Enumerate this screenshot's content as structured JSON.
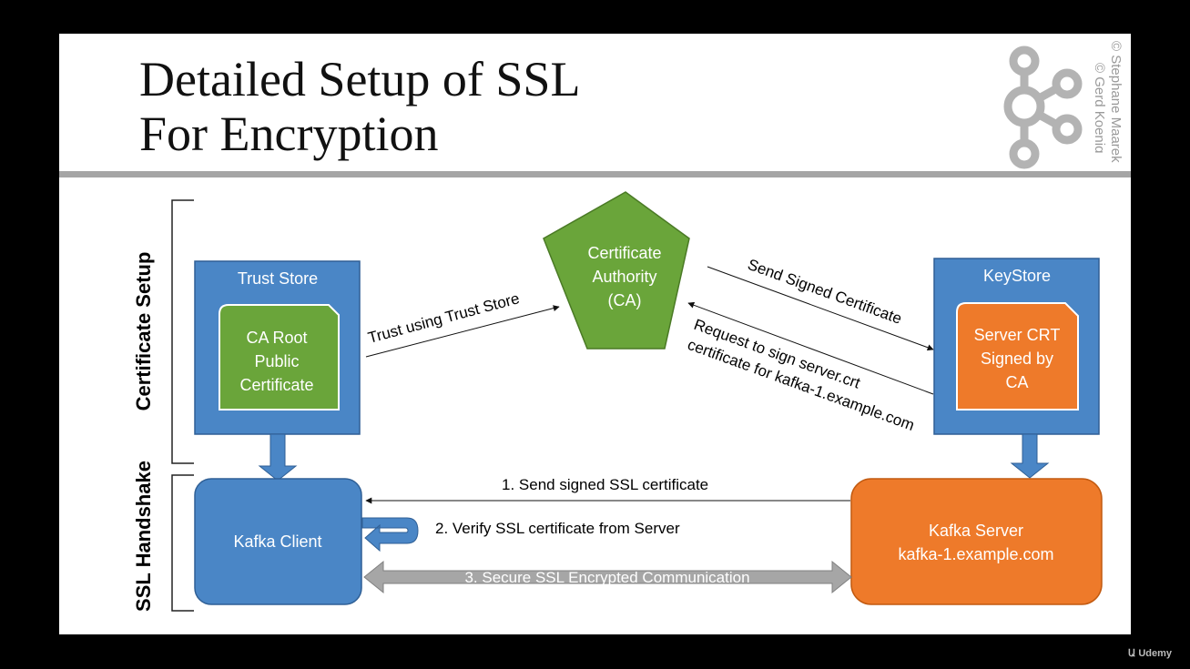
{
  "title": {
    "line1": "Detailed Setup of SSL",
    "line2": "For Encryption"
  },
  "copyright": {
    "line1": "© Stephane Maarek",
    "line2": "© Gerd Koenig"
  },
  "sections": {
    "certificate_setup": "Certificate Setup",
    "ssl_handshake": "SSL Handshake"
  },
  "trust_store": {
    "label": "Trust Store",
    "cert_line1": "CA Root",
    "cert_line2": "Public",
    "cert_line3": "Certificate"
  },
  "ca": {
    "line1": "Certificate",
    "line2": "Authority",
    "line3": "(CA)"
  },
  "keystore": {
    "label": "KeyStore",
    "cert_line1": "Server CRT",
    "cert_line2": "Signed by",
    "cert_line3": "CA"
  },
  "edges": {
    "trust": "Trust using Trust Store",
    "send_signed": "Send Signed Certificate",
    "request_line1": "Request to sign server.crt",
    "request_line2": "certificate for kafka-1.example.com",
    "step1": "1. Send signed SSL certificate",
    "step2": "2. Verify SSL certificate from Server",
    "step3": "3. Secure SSL Encrypted Communication"
  },
  "kafka_client": {
    "label": "Kafka Client"
  },
  "kafka_server": {
    "line1": "Kafka Server",
    "line2": "kafka-1.example.com"
  },
  "watermark": "Udemy",
  "colors": {
    "blue": "#4a86c6",
    "blue_border": "#2f5f95",
    "green": "#6aa53a",
    "green_border": "#4a7a25",
    "orange": "#ee7a2a",
    "orange_border": "#c25a10",
    "gray_arrow": "#a6a6a6",
    "rule": "#a5a5a5"
  }
}
